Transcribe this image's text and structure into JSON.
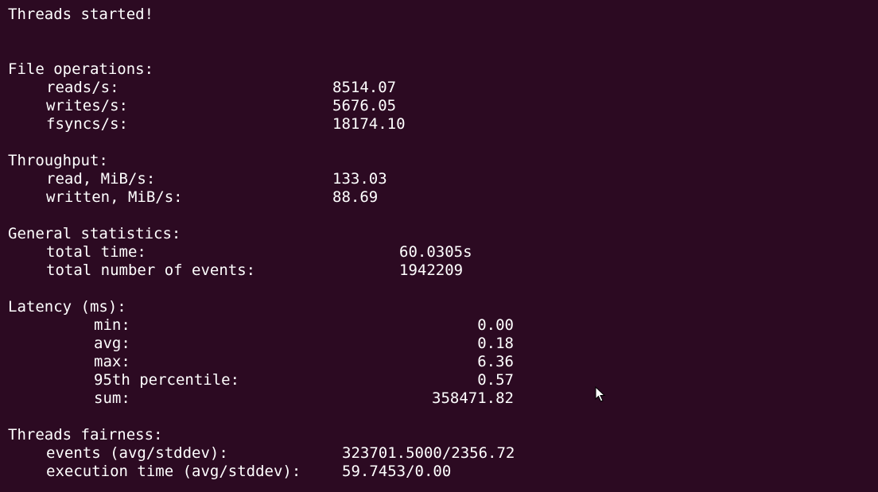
{
  "banner": "Threads started!",
  "file_operations": {
    "heading": "File operations:",
    "rows": [
      {
        "label": "reads/s:",
        "value": "8514.07"
      },
      {
        "label": "writes/s:",
        "value": "5676.05"
      },
      {
        "label": "fsyncs/s:",
        "value": "18174.10"
      }
    ]
  },
  "throughput": {
    "heading": "Throughput:",
    "rows": [
      {
        "label": "read, MiB/s:",
        "value": "133.03"
      },
      {
        "label": "written, MiB/s:",
        "value": "88.69"
      }
    ]
  },
  "general_statistics": {
    "heading": "General statistics:",
    "rows": [
      {
        "label": "total time:",
        "value": "60.0305s"
      },
      {
        "label": "total number of events:",
        "value": "1942209"
      }
    ]
  },
  "latency": {
    "heading": "Latency (ms):",
    "rows": [
      {
        "label": "min:",
        "value": "0.00"
      },
      {
        "label": "avg:",
        "value": "0.18"
      },
      {
        "label": "max:",
        "value": "6.36"
      },
      {
        "label": "95th percentile:",
        "value": "0.57"
      },
      {
        "label": "sum:",
        "value": "358471.82"
      }
    ]
  },
  "threads_fairness": {
    "heading": "Threads fairness:",
    "rows": [
      {
        "label": "events (avg/stddev):",
        "value": "323701.5000/2356.72"
      },
      {
        "label": "execution time (avg/stddev):",
        "value": "59.7453/0.00"
      }
    ]
  },
  "icons": {
    "cursor": "mouse-pointer-icon"
  }
}
